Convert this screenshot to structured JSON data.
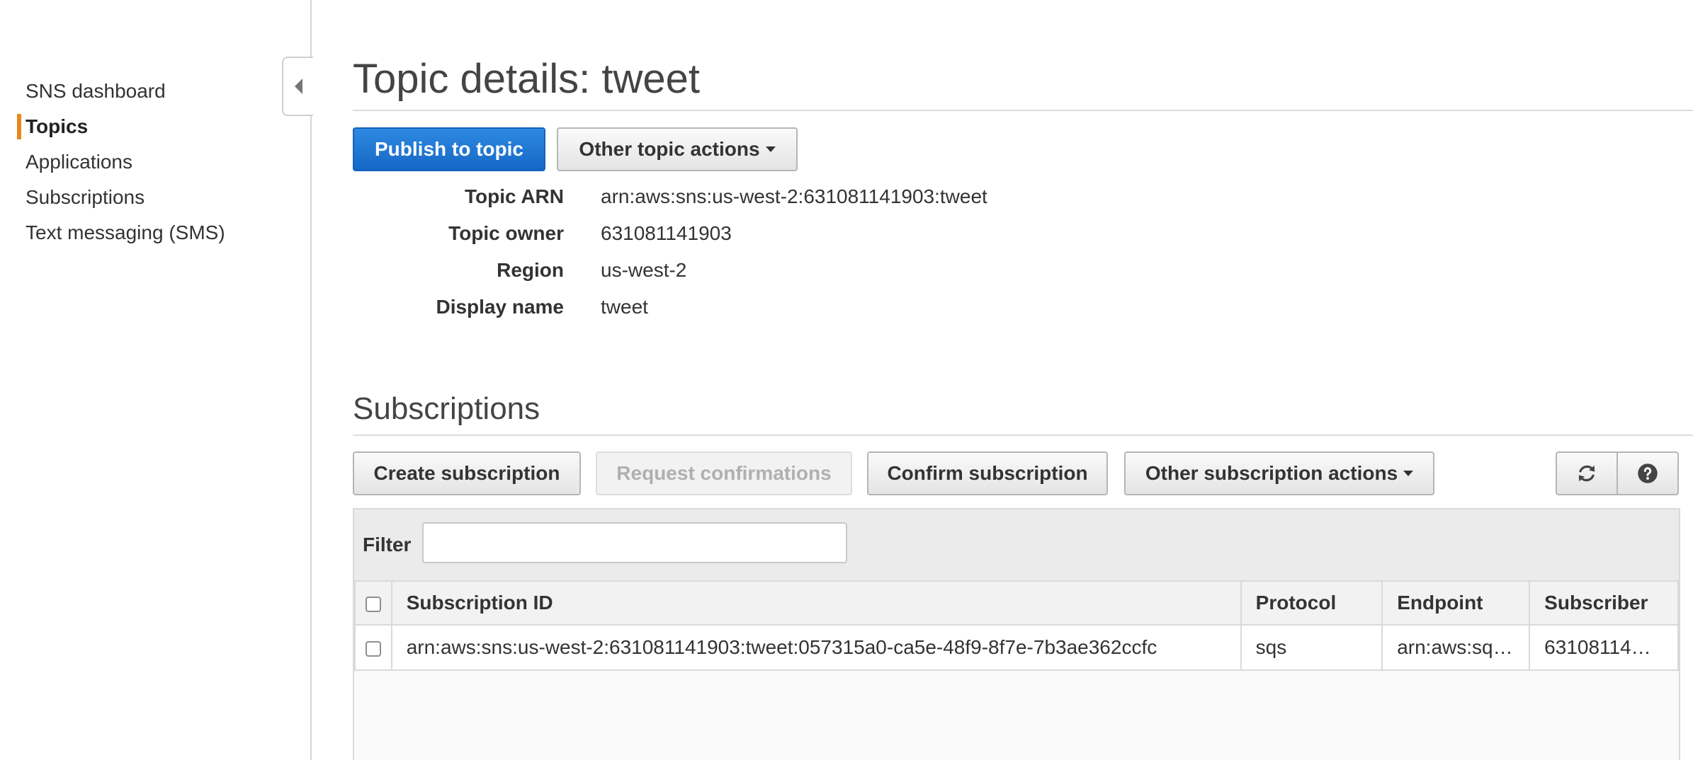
{
  "sidebar": {
    "items": [
      {
        "label": "SNS dashboard",
        "active": false
      },
      {
        "label": "Topics",
        "active": true
      },
      {
        "label": "Applications",
        "active": false
      },
      {
        "label": "Subscriptions",
        "active": false
      },
      {
        "label": "Text messaging (SMS)",
        "active": false
      }
    ],
    "collapse_icon": "triangle-left-icon",
    "accent_color": "#e7891a"
  },
  "page": {
    "title": "Topic details: tweet"
  },
  "topic_actions": {
    "publish_label": "Publish to topic",
    "other_actions_label": "Other topic actions"
  },
  "details": [
    {
      "label": "Topic ARN",
      "value": "arn:aws:sns:us-west-2:631081141903:tweet"
    },
    {
      "label": "Topic owner",
      "value": "631081141903"
    },
    {
      "label": "Region",
      "value": "us-west-2"
    },
    {
      "label": "Display name",
      "value": "tweet"
    }
  ],
  "subscriptions": {
    "title": "Subscriptions",
    "buttons": {
      "create": "Create subscription",
      "request_confirmations": "Request confirmations",
      "confirm": "Confirm subscription",
      "other_actions": "Other subscription actions"
    },
    "icons": [
      "refresh-icon",
      "help-icon"
    ],
    "filter": {
      "label": "Filter",
      "value": "",
      "placeholder": ""
    },
    "columns": [
      "Subscription ID",
      "Protocol",
      "Endpoint",
      "Subscriber"
    ],
    "rows": [
      {
        "subscription_id": "arn:aws:sns:us-west-2:631081141903:tweet:057315a0-ca5e-48f9-8f7e-7b3ae362ccfc",
        "protocol": "sqs",
        "endpoint": "arn:aws:sq…",
        "subscriber": "63108114…"
      }
    ]
  },
  "colors": {
    "primary_button": "#1667c6",
    "active_nav_marker": "#e7891a"
  }
}
